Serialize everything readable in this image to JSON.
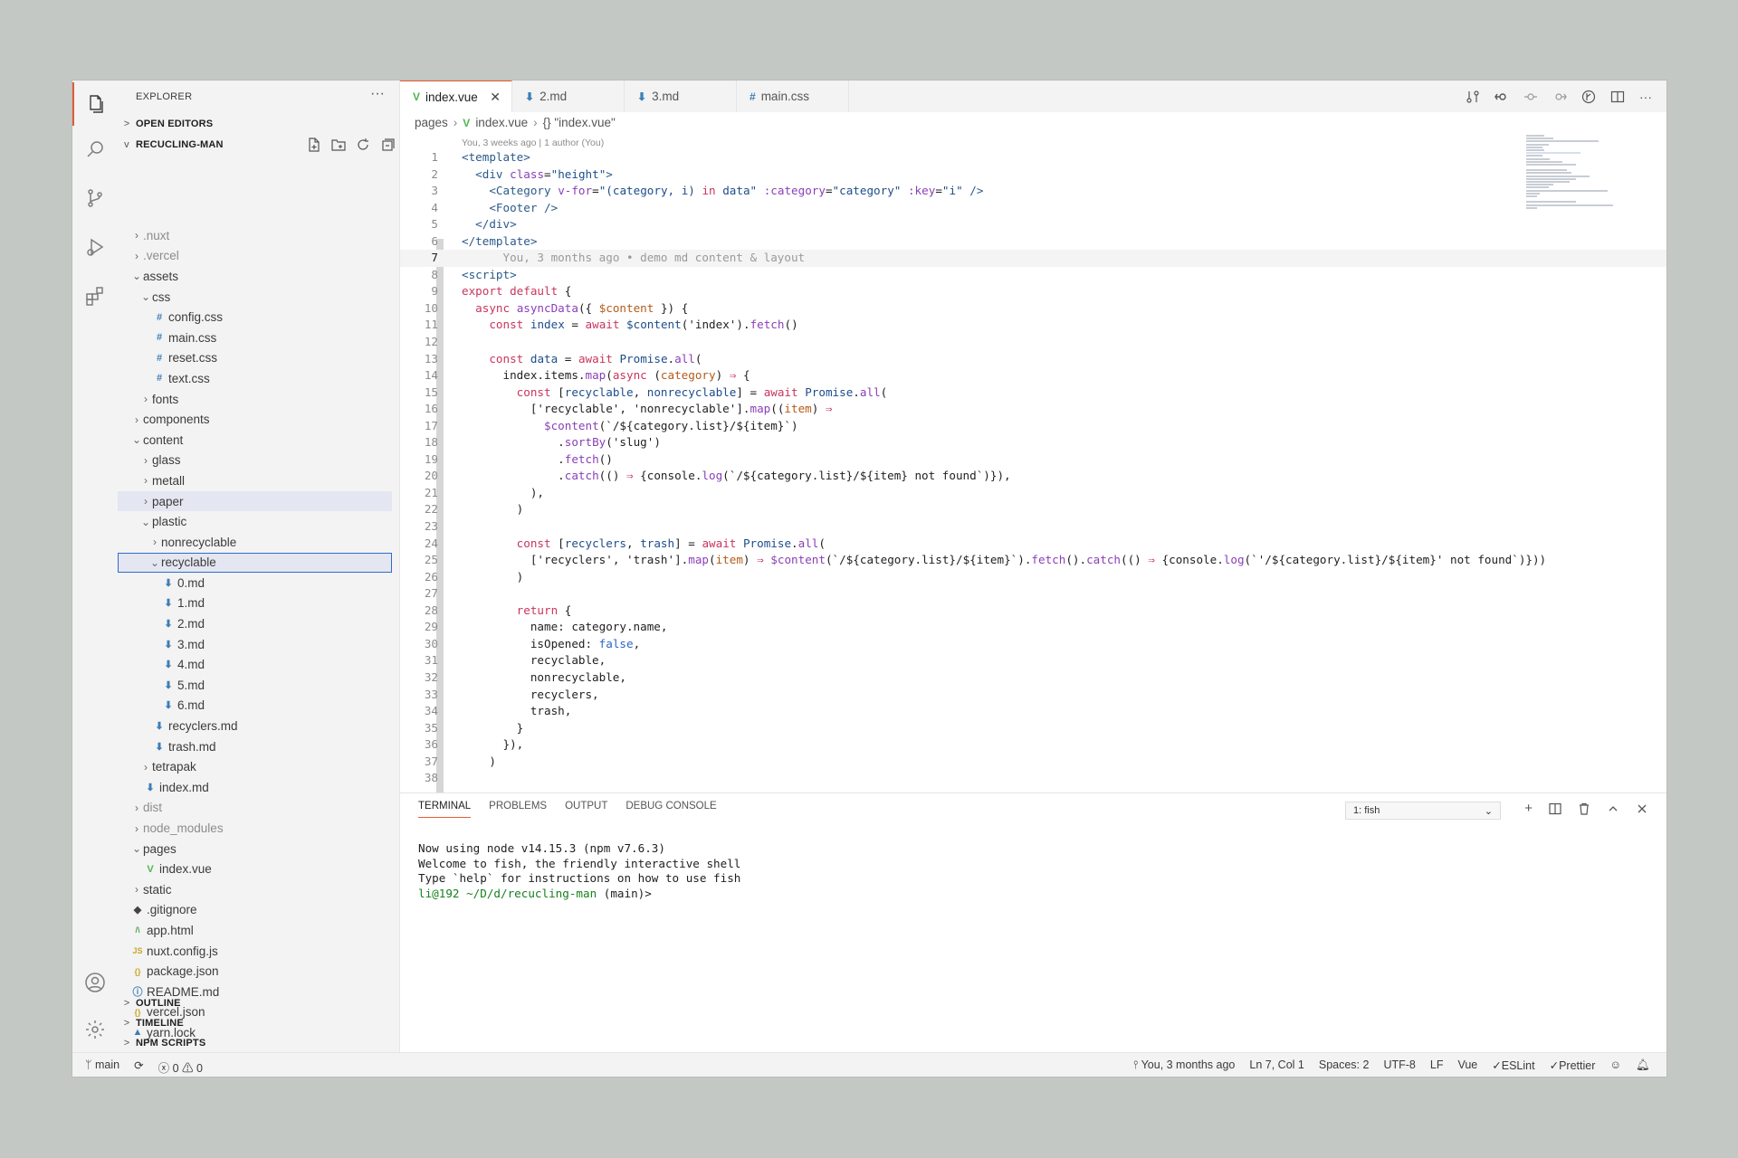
{
  "colors": {
    "accent": "#e25d33",
    "selection_border": "#2f6dcc",
    "keyword": "#c9355e",
    "tag": "#2b5a8b",
    "attr": "#8a3fb8",
    "vue_icon": "#4fb54f",
    "md_icon": "#3d7eb5"
  },
  "sidebar": {
    "title": "EXPLORER",
    "more": "···",
    "open_editors": "OPEN EDITORS",
    "project": "RECUCLING-MAN",
    "outline": "OUTLINE",
    "timeline": "TIMELINE",
    "npm_scripts": "NPM SCRIPTS",
    "tree": [
      {
        "label": ".nuxt",
        "twisty": ">",
        "icon": "",
        "level": 0,
        "dim": true
      },
      {
        "label": ".vercel",
        "twisty": ">",
        "icon": "",
        "level": 0,
        "dim": true
      },
      {
        "label": "assets",
        "twisty": "v",
        "icon": "",
        "level": 0
      },
      {
        "label": "css",
        "twisty": "v",
        "icon": "",
        "level": 1
      },
      {
        "label": "config.css",
        "twisty": "",
        "icon": "#",
        "level": 1
      },
      {
        "label": "main.css",
        "twisty": "",
        "icon": "#",
        "level": 1
      },
      {
        "label": "reset.css",
        "twisty": "",
        "icon": "#",
        "level": 1
      },
      {
        "label": "text.css",
        "twisty": "",
        "icon": "#",
        "level": 1
      },
      {
        "label": "fonts",
        "twisty": ">",
        "icon": "",
        "level": 1
      },
      {
        "label": "components",
        "twisty": ">",
        "icon": "",
        "level": 0
      },
      {
        "label": "content",
        "twisty": "v",
        "icon": "",
        "level": 0
      },
      {
        "label": "glass",
        "twisty": ">",
        "icon": "",
        "level": 1
      },
      {
        "label": "metall",
        "twisty": ">",
        "icon": "",
        "level": 1
      },
      {
        "label": "paper",
        "twisty": ">",
        "icon": "",
        "level": 1,
        "hl": true
      },
      {
        "label": "plastic",
        "twisty": "v",
        "icon": "",
        "level": 1
      },
      {
        "label": "nonrecyclable",
        "twisty": ">",
        "icon": "",
        "level": 2
      },
      {
        "label": "recyclable",
        "twisty": "v",
        "icon": "",
        "level": 2,
        "sel": true
      },
      {
        "label": "0.md",
        "twisty": "",
        "icon": "⬇",
        "level": 2
      },
      {
        "label": "1.md",
        "twisty": "",
        "icon": "⬇",
        "level": 2
      },
      {
        "label": "2.md",
        "twisty": "",
        "icon": "⬇",
        "level": 2
      },
      {
        "label": "3.md",
        "twisty": "",
        "icon": "⬇",
        "level": 2
      },
      {
        "label": "4.md",
        "twisty": "",
        "icon": "⬇",
        "level": 2
      },
      {
        "label": "5.md",
        "twisty": "",
        "icon": "⬇",
        "level": 2
      },
      {
        "label": "6.md",
        "twisty": "",
        "icon": "⬇",
        "level": 2
      },
      {
        "label": "recyclers.md",
        "twisty": "",
        "icon": "⬇",
        "level": 1
      },
      {
        "label": "trash.md",
        "twisty": "",
        "icon": "⬇",
        "level": 1
      },
      {
        "label": "tetrapak",
        "twisty": ">",
        "icon": "",
        "level": 1
      },
      {
        "label": "index.md",
        "twisty": "",
        "icon": "⬇",
        "level": 0
      },
      {
        "label": "dist",
        "twisty": ">",
        "icon": "",
        "level": 0,
        "dim": true
      },
      {
        "label": "node_modules",
        "twisty": ">",
        "icon": "",
        "level": 0,
        "dim": true
      },
      {
        "label": "pages",
        "twisty": "v",
        "icon": "",
        "level": 0
      },
      {
        "label": "index.vue",
        "twisty": "",
        "icon": "V",
        "level": 0
      },
      {
        "label": "static",
        "twisty": ">",
        "icon": "",
        "level": 0
      },
      {
        "label": ".gitignore",
        "twisty": "",
        "icon": "◆",
        "level": -1
      },
      {
        "label": "app.html",
        "twisty": "",
        "icon": "/\\",
        "level": -1
      },
      {
        "label": "nuxt.config.js",
        "twisty": "",
        "icon": "JS",
        "level": -1
      },
      {
        "label": "package.json",
        "twisty": "",
        "icon": "{}",
        "level": -1
      },
      {
        "label": "README.md",
        "twisty": "",
        "icon": "ⓘ",
        "level": -1
      },
      {
        "label": "vercel.json",
        "twisty": "",
        "icon": "{}",
        "level": -1
      },
      {
        "label": "yarn.lock",
        "twisty": "",
        "icon": "▲",
        "level": -1
      }
    ]
  },
  "tabs": [
    {
      "label": "index.vue",
      "icon": "V",
      "active": true
    },
    {
      "label": "2.md",
      "icon": "⬇"
    },
    {
      "label": "3.md",
      "icon": "⬇"
    },
    {
      "label": "main.css",
      "icon": "#"
    }
  ],
  "breadcrumb": {
    "p1": "pages",
    "p2": "index.vue",
    "p3": "{} \"index.vue\""
  },
  "editor": {
    "blame_header": "You, 3 weeks ago | 1 author (You)",
    "lines": [
      {
        "n": "1",
        "h": "<span class='t'>&lt;template&gt;</span>"
      },
      {
        "n": "2",
        "h": "  <span class='t'>&lt;div</span> <span class='a'>class</span>=<span class='s'>\"height\"</span><span class='t'>&gt;</span>"
      },
      {
        "n": "3",
        "h": "    <span class='t'>&lt;Category</span> <span class='a'>v-for</span>=<span class='s'>\"(category, i) </span><span class='k'>in</span><span class='s'> data\"</span> <span class='a'>:category</span>=<span class='s'>\"category\"</span> <span class='a'>:key</span>=<span class='s'>\"i\"</span> <span class='t'>/&gt;</span>"
      },
      {
        "n": "4",
        "h": "    <span class='t'>&lt;Footer</span> <span class='t'>/&gt;</span>"
      },
      {
        "n": "5",
        "h": "  <span class='t'>&lt;/div&gt;</span>"
      },
      {
        "n": "6",
        "h": "<span class='t'>&lt;/template&gt;</span>"
      },
      {
        "n": "7",
        "h": "      <span class='g'>You, 3 months ago • demo md content &amp; layout</span>",
        "cur": true
      },
      {
        "n": "8",
        "h": "<span class='t'>&lt;script&gt;</span>"
      },
      {
        "n": "9",
        "h": "<span class='k'>export default</span> {"
      },
      {
        "n": "10",
        "h": "  <span class='k'>async</span> <span class='f'>asyncData</span>({ <span class='v'>$content</span> }) {"
      },
      {
        "n": "11",
        "h": "    <span class='k'>const</span> <span class='s'>index</span> = <span class='k'>await</span> <span class='s'>$content</span>(<span class='p'>'index'</span>).<span class='f'>fetch</span>()"
      },
      {
        "n": "12",
        "h": ""
      },
      {
        "n": "13",
        "h": "    <span class='k'>const</span> <span class='s'>data</span> = <span class='k'>await</span> <span class='s'>Promise</span>.<span class='f'>all</span>("
      },
      {
        "n": "14",
        "h": "      index.items.<span class='f'>map</span>(<span class='k'>async</span> (<span class='v'>category</span>) <span class='k'>⇒</span> {"
      },
      {
        "n": "15",
        "h": "        <span class='k'>const</span> [<span class='s'>recyclable</span>, <span class='s'>nonrecyclable</span>] = <span class='k'>await</span> <span class='s'>Promise</span>.<span class='f'>all</span>("
      },
      {
        "n": "16",
        "h": "          [<span class='p'>'recyclable'</span>, <span class='p'>'nonrecyclable'</span>].<span class='f'>map</span>((<span class='v'>item</span>) <span class='k'>⇒</span>"
      },
      {
        "n": "17",
        "h": "            <span class='f'>$content</span>(`/${category.list}/${item}`)"
      },
      {
        "n": "18",
        "h": "              .<span class='f'>sortBy</span>(<span class='p'>'slug'</span>)"
      },
      {
        "n": "19",
        "h": "              .<span class='f'>fetch</span>()"
      },
      {
        "n": "20",
        "h": "              .<span class='f'>catch</span>(() <span class='k'>⇒</span> {console.<span class='f'>log</span>(`/${category.list}/${item} not found`)}),"
      },
      {
        "n": "21",
        "h": "          ),"
      },
      {
        "n": "22",
        "h": "        )"
      },
      {
        "n": "23",
        "h": ""
      },
      {
        "n": "24",
        "h": "        <span class='k'>const</span> [<span class='s'>recyclers</span>, <span class='s'>trash</span>] = <span class='k'>await</span> <span class='s'>Promise</span>.<span class='f'>all</span>("
      },
      {
        "n": "25",
        "h": "          [<span class='p'>'recyclers'</span>, <span class='p'>'trash'</span>].<span class='f'>map</span>(<span class='v'>item</span>) <span class='k'>⇒</span> <span class='f'>$content</span>(`/${category.list}/${item}`).<span class='f'>fetch</span>().<span class='f'>catch</span>(() <span class='k'>⇒</span> {console.<span class='f'>log</span>(`'/${category.list}/${item}' not found`)}))"
      },
      {
        "n": "26",
        "h": "        )"
      },
      {
        "n": "27",
        "h": ""
      },
      {
        "n": "28",
        "h": "        <span class='k'>return</span> {"
      },
      {
        "n": "29",
        "h": "          name: category.name,"
      },
      {
        "n": "30",
        "h": "          isOpened: <span class='b'>false</span>,"
      },
      {
        "n": "31",
        "h": "          recyclable,"
      },
      {
        "n": "32",
        "h": "          nonrecyclable,"
      },
      {
        "n": "33",
        "h": "          recyclers,"
      },
      {
        "n": "34",
        "h": "          trash,"
      },
      {
        "n": "35",
        "h": "        }"
      },
      {
        "n": "36",
        "h": "      }),"
      },
      {
        "n": "37",
        "h": "    )"
      },
      {
        "n": "38",
        "h": ""
      }
    ]
  },
  "panel": {
    "tabs": [
      "TERMINAL",
      "PROBLEMS",
      "OUTPUT",
      "DEBUG CONSOLE"
    ],
    "terminal_select": "1: fish",
    "lines": [
      "Now using node v14.15.3 (npm v7.6.3)",
      "Welcome to fish, the friendly interactive shell",
      "Type `help` for instructions on how to use fish"
    ],
    "prompt_user": "li@192",
    "prompt_path": "~/D/d/recucling-man",
    "prompt_branch": "(main)>"
  },
  "status": {
    "branch": "main",
    "errors": "0",
    "warnings": "0",
    "blame": "You, 3 months ago",
    "position": "Ln 7, Col 1",
    "spaces": "Spaces: 2",
    "encoding": "UTF-8",
    "eol": "LF",
    "language": "Vue",
    "eslint": "ESLint",
    "prettier": "Prettier"
  }
}
